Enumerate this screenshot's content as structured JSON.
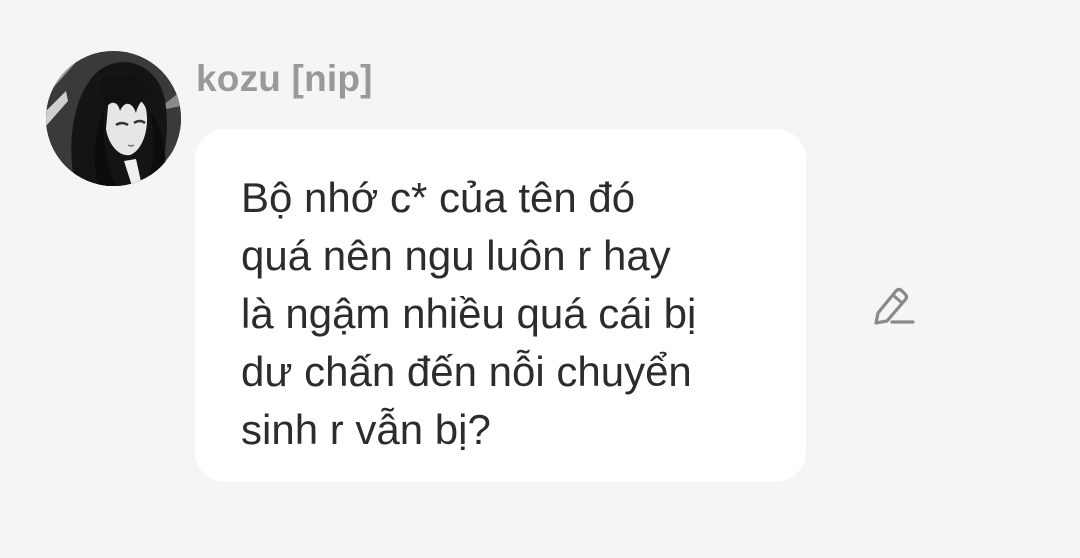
{
  "message": {
    "sender": "kozu [nip]",
    "text": "Bộ nhớ c* của tên đó\nquá nên ngu luôn r hay\nlà ngậm nhiều quá cái bị\ndư chấn đến nỗi chuyển\nsinh r vẫn bị?"
  },
  "icons": {
    "edit": "pencil-icon"
  },
  "colors": {
    "background": "#f5f5f5",
    "bubble": "#ffffff",
    "sender_name": "#999999",
    "message_text": "#2c2c2c",
    "icon": "#8a8a8a"
  }
}
